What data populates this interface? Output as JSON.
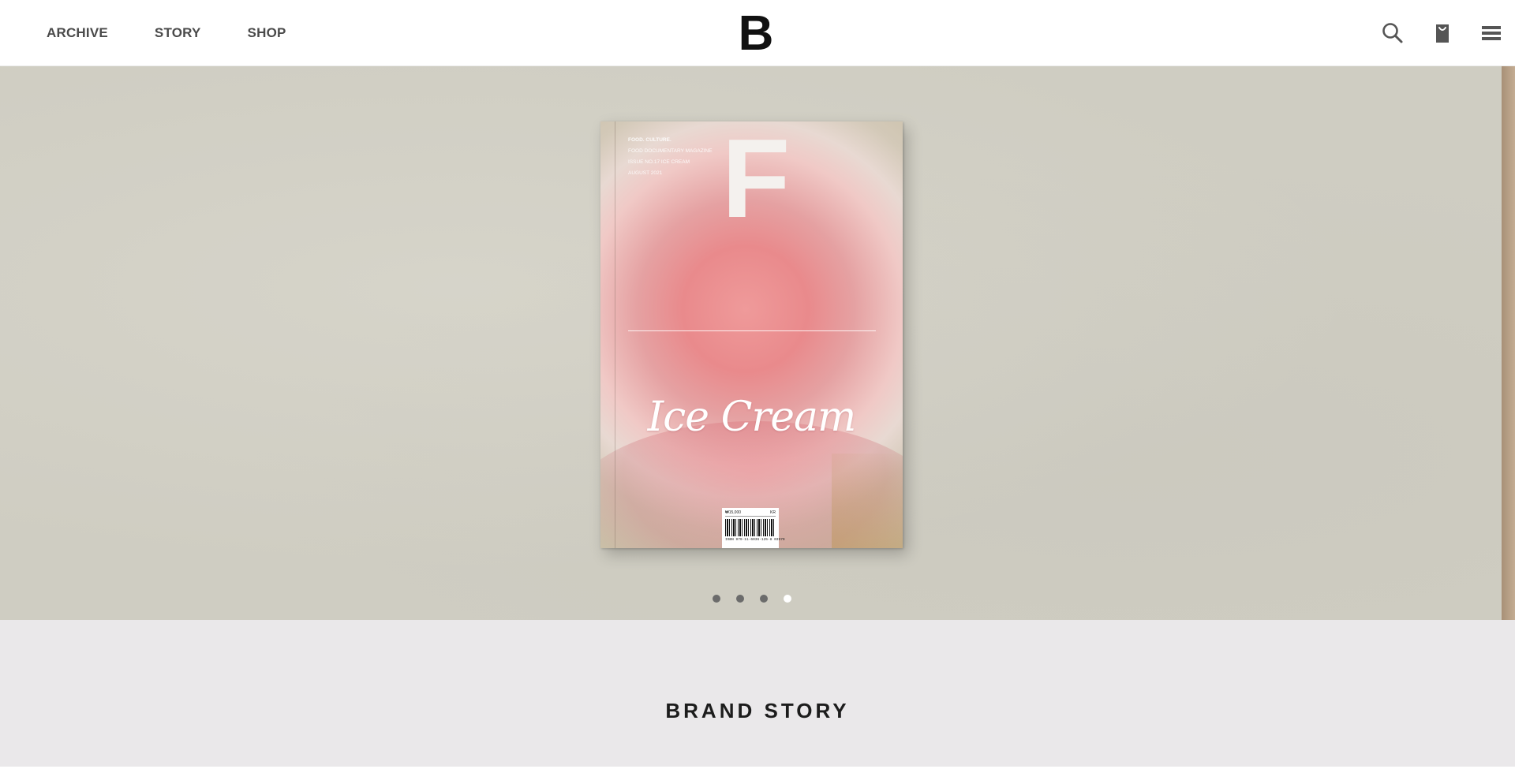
{
  "header": {
    "nav": [
      {
        "label": "ARCHIVE"
      },
      {
        "label": "STORY"
      },
      {
        "label": "SHOP"
      }
    ],
    "logo": "B",
    "icons": [
      "search-icon",
      "cart-icon",
      "menu-icon"
    ]
  },
  "hero": {
    "slide": {
      "cover_letter": "F",
      "meta_lines": {
        "line1": "FOOD. CULTURE.",
        "line2": "FOOD DOCUMENTARY MAGAZINE",
        "line3": "ISSUE NO.17 ICE CREAM",
        "line4": "AUGUST 2021"
      },
      "cover_title": "Ice Cream",
      "barcode": {
        "price": "₩15,000",
        "code": "KR",
        "number": "ISBN 979-11-6036-125-8 03970"
      }
    },
    "dots": {
      "count": 4,
      "active_index": 3
    }
  },
  "brand": {
    "title": "BRAND STORY"
  },
  "colors": {
    "hero_bg": "#cfcdc2",
    "brand_bg": "#eae8ea",
    "nav_text": "#4a4a4a",
    "dot_inactive": "#6b6b6b",
    "dot_active": "#ffffff"
  }
}
